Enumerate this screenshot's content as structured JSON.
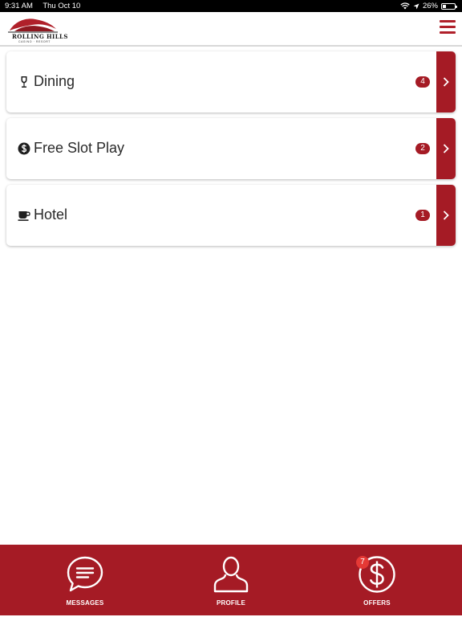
{
  "status_bar": {
    "time": "9:31 AM",
    "date": "Thu Oct 10",
    "battery": "26%",
    "battery_level": 0.26
  },
  "header": {
    "logo_text": "ROLLING HILLS",
    "logo_subtext": "CASINO · RESORT",
    "menu_icon": "hamburger-menu-icon",
    "accent_color": "#a51b25"
  },
  "categories": [
    {
      "label": "Dining",
      "count": "4",
      "icon": "wine-glass-icon"
    },
    {
      "label": "Free Slot Play",
      "count": "2",
      "icon": "dollar-coin-icon"
    },
    {
      "label": "Hotel",
      "count": "1",
      "icon": "coffee-cup-icon"
    }
  ],
  "tabbar": {
    "background": "#a51b25",
    "tabs": [
      {
        "label": "MESSAGES",
        "icon": "chat-bubble-icon"
      },
      {
        "label": "PROFILE",
        "icon": "person-icon"
      },
      {
        "label": "OFFERS",
        "icon": "dollar-circle-icon",
        "badge": "7"
      }
    ]
  }
}
